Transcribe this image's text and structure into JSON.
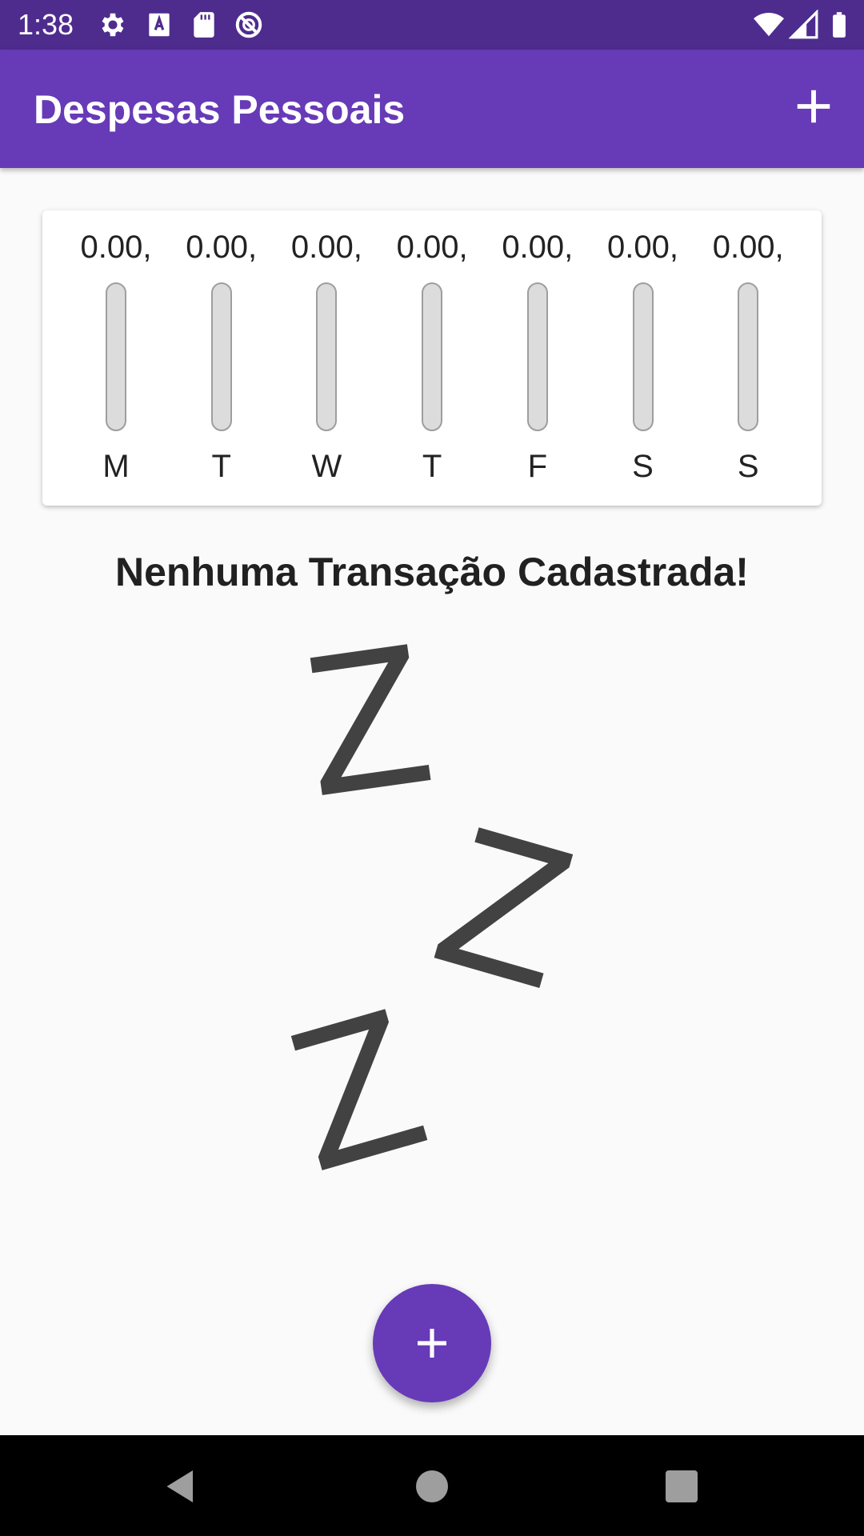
{
  "status_bar": {
    "time": "1:38",
    "left_icons": [
      "settings-icon",
      "text-a-icon",
      "sd-card-icon",
      "do-not-disturb-icon"
    ],
    "right_icons": [
      "wifi-icon",
      "cell-signal-icon",
      "battery-icon"
    ]
  },
  "app_bar": {
    "title": "Despesas Pessoais",
    "action_icon": "add-icon"
  },
  "chart_data": {
    "type": "bar",
    "categories": [
      "M",
      "T",
      "W",
      "T",
      "F",
      "S",
      "S"
    ],
    "values": [
      0,
      0,
      0,
      0,
      0,
      0,
      0
    ],
    "value_labels": [
      "0.00,",
      "0.00,",
      "0.00,",
      "0.00,",
      "0.00,",
      "0.00,",
      "0.00,"
    ],
    "ylim": [
      0,
      1
    ],
    "title": "",
    "xlabel": "",
    "ylabel": "",
    "colors": {
      "fill": "#673ab7",
      "track": "#dcdcdc",
      "track_border": "#9e9e9e"
    }
  },
  "empty_state": {
    "message": "Nenhuma Transação Cadastrada!",
    "image_icon": "sleeping-zzz-icon",
    "glyph": "Z"
  },
  "fab": {
    "icon": "add-icon"
  },
  "nav_bar": {
    "icons": [
      "back-icon",
      "home-icon",
      "recents-icon"
    ]
  },
  "colors": {
    "primary": "#673ab7",
    "primary_dark": "#4e2c8e",
    "background": "#fafafa",
    "text": "#212121"
  }
}
